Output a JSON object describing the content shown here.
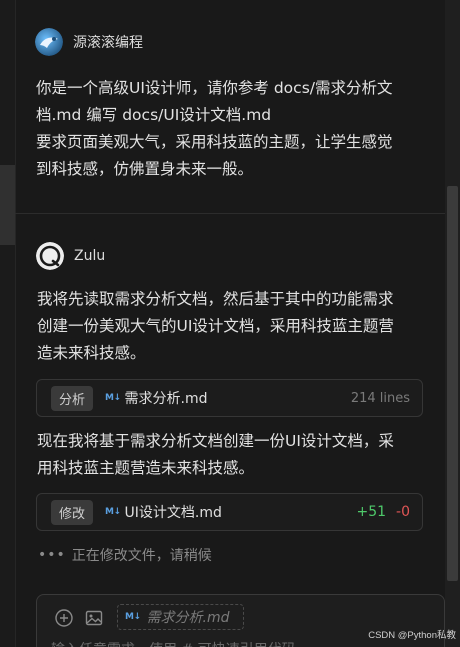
{
  "user_message": {
    "author": "源滚滚编程",
    "text": "你是一个高级UI设计师，请你参考 docs/需求分析文\n档.md 编写 docs/UI设计文档.md\n要求页面美观大气，采用科技蓝的主题，让学生感觉\n到科技感，仿佛置身未来一般。"
  },
  "assistant_message": {
    "author": "Zulu",
    "intro_text": "我将先读取需求分析文档，然后基于其中的功能需求\n创建一份美观大气的UI设计文档，采用科技蓝主题营\n造未来科技感。",
    "read_card": {
      "action": "分析",
      "icon": "markdown-icon",
      "filename": "需求分析.md",
      "meta": "214 lines"
    },
    "followup_text": "现在我将基于需求分析文档创建一份UI设计文档，采\n用科技蓝主题营造未来科技感。",
    "edit_card": {
      "action": "修改",
      "icon": "markdown-icon",
      "filename": "UI设计文档.md",
      "additions": "+51",
      "deletions": "-0"
    },
    "status": {
      "dots": "•••",
      "text": "正在修改文件，请稍候"
    }
  },
  "input": {
    "context_chip": "需求分析.md",
    "placeholder": "输入任意需求，使用 # 可快速引用代码"
  },
  "watermark": "CSDN @Python私教",
  "colors": {
    "background": "#191919",
    "addition": "#4ec96a",
    "deletion": "#e05555",
    "markdown_icon": "#5a9fe0"
  }
}
